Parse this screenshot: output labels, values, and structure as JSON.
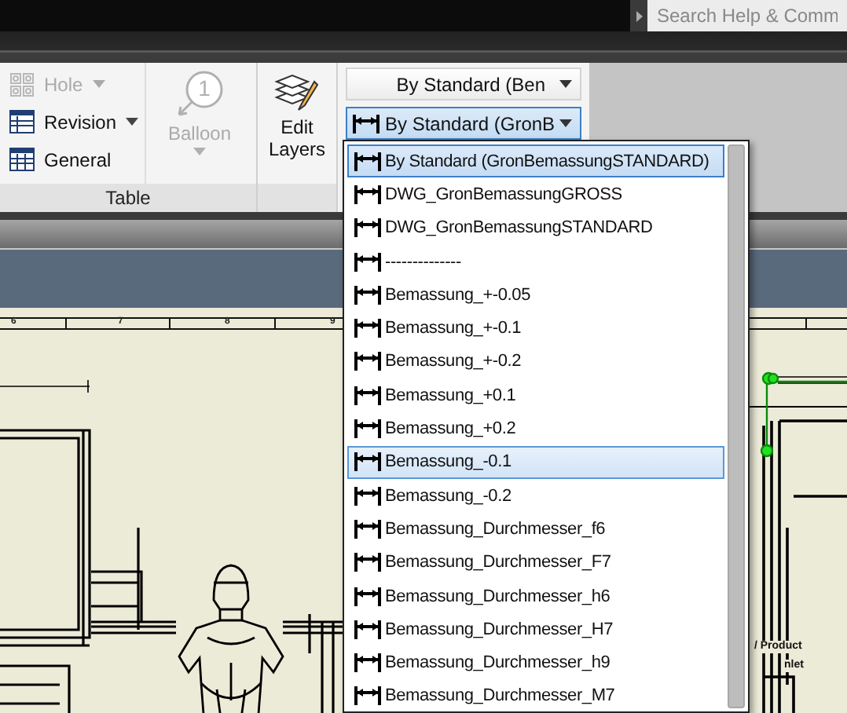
{
  "search": {
    "placeholder": "Search Help & Comm"
  },
  "table_panel": {
    "title": "Table",
    "tools": [
      {
        "kind": "hole",
        "label": "Hole",
        "disabled": true,
        "has_menu": true
      },
      {
        "kind": "revision",
        "label": "Revision",
        "disabled": false,
        "has_menu": true
      },
      {
        "kind": "general",
        "label": "General",
        "disabled": false,
        "has_menu": false
      }
    ],
    "balloon": {
      "label": "Balloon",
      "badge": "1",
      "disabled": true
    }
  },
  "edit_layers": {
    "label": "Edit Layers"
  },
  "style_combos": [
    {
      "value": "By Standard (Ben",
      "icon": false,
      "focused": false
    },
    {
      "value": "By Standard (GronB",
      "icon": true,
      "focused": true
    }
  ],
  "style_list": {
    "items": [
      {
        "label": "By Standard (GronBemassungSTANDARD)",
        "selected": true,
        "hovered": false
      },
      {
        "label": "DWG_GronBemassungGROSS",
        "selected": false,
        "hovered": false
      },
      {
        "label": "DWG_GronBemassungSTANDARD",
        "selected": false,
        "hovered": false
      },
      {
        "label": "--------------",
        "selected": false,
        "hovered": false
      },
      {
        "label": "Bemassung_+-0.05",
        "selected": false,
        "hovered": false
      },
      {
        "label": "Bemassung_+-0.1",
        "selected": false,
        "hovered": false
      },
      {
        "label": "Bemassung_+-0.2",
        "selected": false,
        "hovered": false
      },
      {
        "label": "Bemassung_+0.1",
        "selected": false,
        "hovered": false
      },
      {
        "label": "Bemassung_+0.2",
        "selected": false,
        "hovered": false
      },
      {
        "label": "Bemassung_-0.1",
        "selected": false,
        "hovered": true
      },
      {
        "label": "Bemassung_-0.2",
        "selected": false,
        "hovered": false
      },
      {
        "label": "Bemassung_Durchmesser_f6",
        "selected": false,
        "hovered": false
      },
      {
        "label": "Bemassung_Durchmesser_F7",
        "selected": false,
        "hovered": false
      },
      {
        "label": "Bemassung_Durchmesser_h6",
        "selected": false,
        "hovered": false
      },
      {
        "label": "Bemassung_Durchmesser_H7",
        "selected": false,
        "hovered": false
      },
      {
        "label": "Bemassung_Durchmesser_h9",
        "selected": false,
        "hovered": false
      },
      {
        "label": "Bemassung_Durchmesser_M7",
        "selected": false,
        "hovered": false
      }
    ]
  },
  "drawing": {
    "zone_labels": [
      "6",
      "7",
      "8",
      "9"
    ],
    "notes": [
      "/ Product",
      "nlet"
    ]
  }
}
